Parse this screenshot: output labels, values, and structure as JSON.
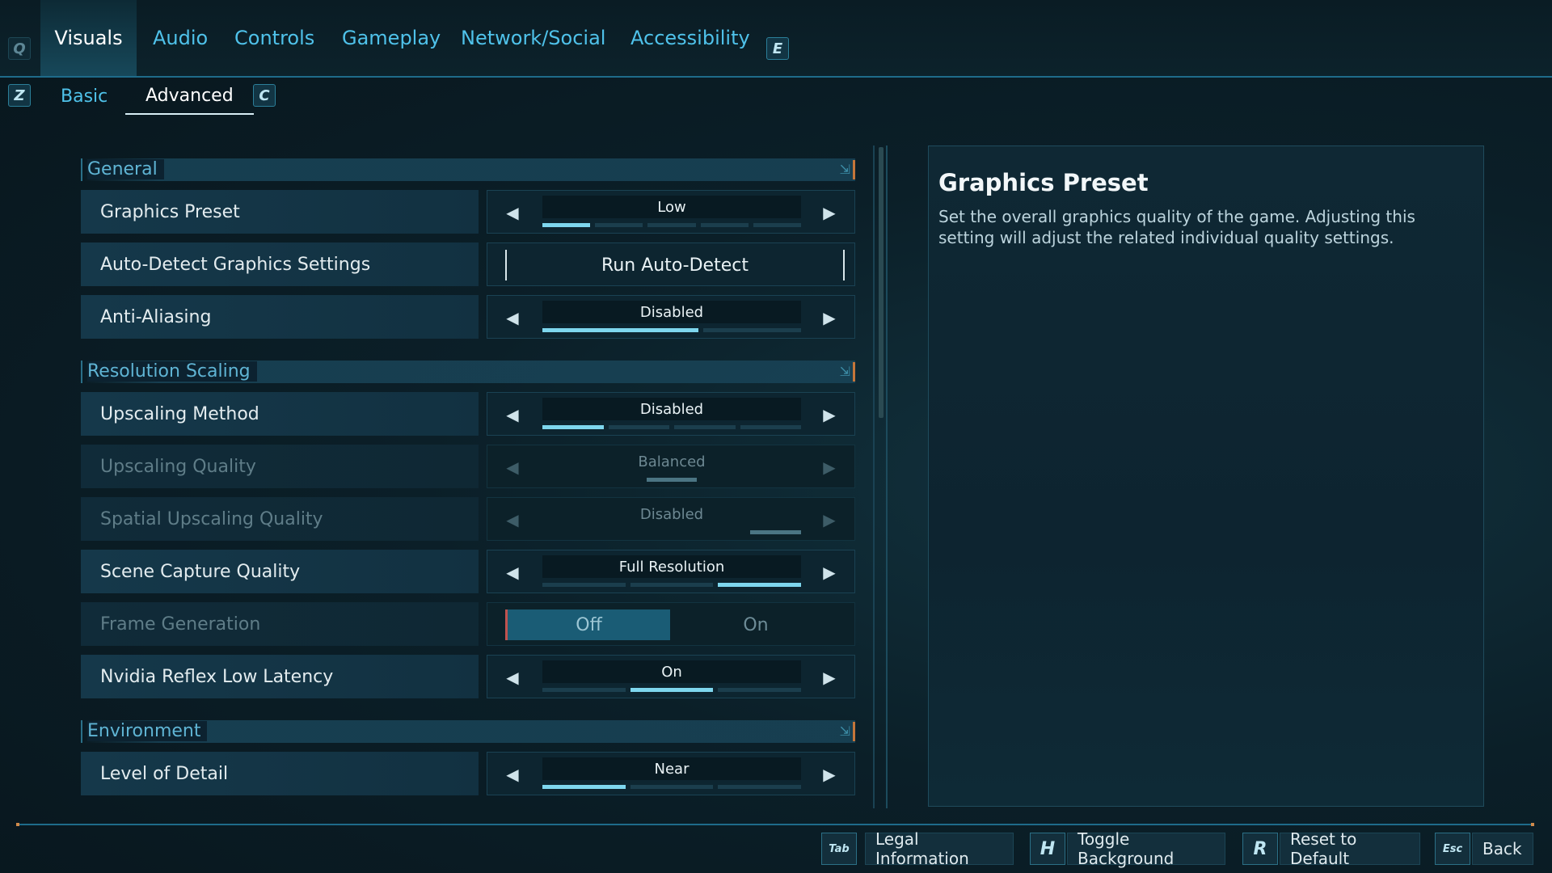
{
  "top_tabs": {
    "left_key": "Q",
    "right_key": "E",
    "items": [
      {
        "label": "Visuals",
        "active": true
      },
      {
        "label": "Audio",
        "active": false
      },
      {
        "label": "Controls",
        "active": false
      },
      {
        "label": "Gameplay",
        "active": false
      },
      {
        "label": "Network/Social",
        "active": false
      },
      {
        "label": "Accessibility",
        "active": false
      }
    ]
  },
  "sub_tabs": {
    "left_key": "Z",
    "right_key": "C",
    "items": [
      {
        "label": "Basic",
        "active": false
      },
      {
        "label": "Advanced",
        "active": true
      }
    ]
  },
  "sections": {
    "general": {
      "title": "General",
      "graphics_preset": {
        "label": "Graphics Preset",
        "value": "Low"
      },
      "auto_detect": {
        "label": "Auto-Detect Graphics Settings",
        "button": "Run Auto-Detect"
      },
      "anti_aliasing": {
        "label": "Anti-Aliasing",
        "value": "Disabled"
      }
    },
    "resolution_scaling": {
      "title": "Resolution Scaling",
      "upscaling_method": {
        "label": "Upscaling Method",
        "value": "Disabled"
      },
      "upscaling_quality": {
        "label": "Upscaling Quality",
        "value": "Balanced"
      },
      "spatial_upscaling_quality": {
        "label": "Spatial Upscaling Quality",
        "value": "Disabled"
      },
      "scene_capture_quality": {
        "label": "Scene Capture Quality",
        "value": "Full Resolution"
      },
      "frame_generation": {
        "label": "Frame Generation",
        "off": "Off",
        "on": "On",
        "selected": "Off"
      },
      "nvidia_reflex": {
        "label": "Nvidia Reflex Low Latency",
        "value": "On"
      }
    },
    "environment": {
      "title": "Environment",
      "level_of_detail": {
        "label": "Level of Detail",
        "value": "Near"
      }
    }
  },
  "info_panel": {
    "title": "Graphics Preset",
    "description": "Set the overall graphics quality of the game. Adjusting this setting will adjust the related individual quality settings."
  },
  "footer": {
    "legal": {
      "key": "Tab",
      "label": "Legal Information"
    },
    "toggle_bg": {
      "key": "H",
      "label": "Toggle Background"
    },
    "reset": {
      "key": "R",
      "label": "Reset to Default"
    },
    "back": {
      "key": "Esc",
      "label": "Back"
    }
  },
  "colors": {
    "accent": "#4fc2ea",
    "background": "#0b1f28",
    "slider_fill": "#7ed7ee",
    "highlight_orange": "#c5763a"
  }
}
